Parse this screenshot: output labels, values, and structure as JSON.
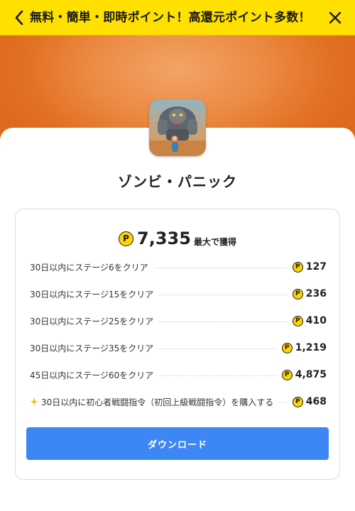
{
  "header": {
    "title": "無料・簡単・即時ポイント！高還元ポイント多数！",
    "back_icon": "chevron-left-icon",
    "close_icon": "close-icon",
    "background_color": "#ffe000"
  },
  "app": {
    "name": "ゾンビ・パニック",
    "icon": "app-icon-zombie-panic"
  },
  "offer": {
    "total_points": "7,335",
    "total_suffix": "最大で獲得",
    "point_symbol": "P",
    "point_color": "#ffd400",
    "tasks": [
      {
        "label": "30日以内にステージ6をクリア",
        "points": "127"
      },
      {
        "label": "30日以内にステージ15をクリア",
        "points": "236"
      },
      {
        "label": "30日以内にステージ25をクリア",
        "points": "410"
      },
      {
        "label": "30日以内にステージ35をクリア",
        "points": "1,219"
      },
      {
        "label": "45日以内にステージ60をクリア",
        "points": "4,875"
      },
      {
        "label": "30日以内に初心者戦闘指令（初回上級戦闘指令）を購入する",
        "points": "468",
        "icon": "sparkle-icon"
      }
    ]
  },
  "actions": {
    "download_label": "ダウンロード",
    "download_color": "#3d87f5"
  }
}
